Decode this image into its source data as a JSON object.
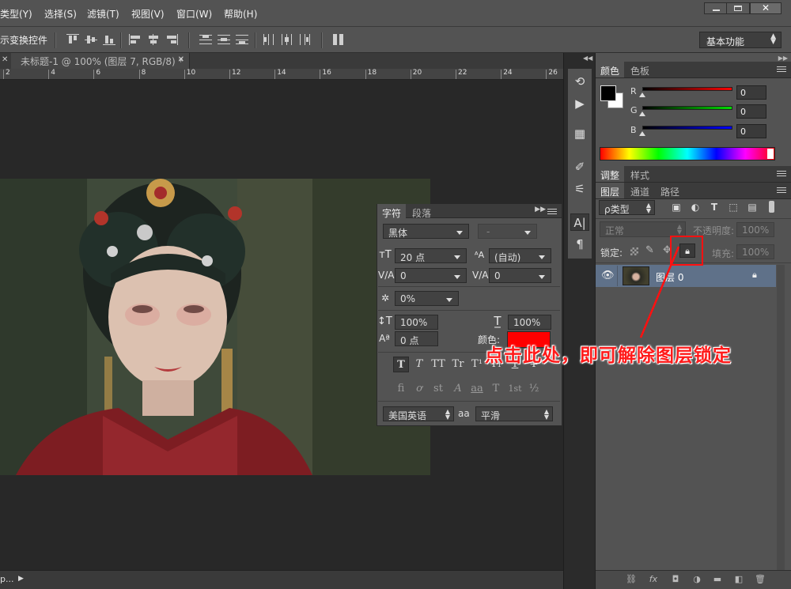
{
  "menu": {
    "items": [
      "类型(Y)",
      "选择(S)",
      "滤镜(T)",
      "视图(V)",
      "窗口(W)",
      "帮助(H)"
    ]
  },
  "options_bar": {
    "transform_label": "示变换控件",
    "workspace": "基本功能"
  },
  "document": {
    "tab_title": "未标题-1 @ 100% (图层 7, RGB/8) *",
    "ruler_labels": [
      "2",
      "4",
      "6",
      "8",
      "10",
      "12",
      "14",
      "16",
      "18",
      "20",
      "22",
      "24",
      "26"
    ],
    "status": "p..."
  },
  "color_panel": {
    "tabs": [
      "颜色",
      "色板"
    ],
    "channels": [
      {
        "label": "R",
        "value": "0",
        "color": "#ff0000"
      },
      {
        "label": "G",
        "value": "0",
        "color": "#00dd00"
      },
      {
        "label": "B",
        "value": "0",
        "color": "#0000ff"
      }
    ]
  },
  "adjust_panel": {
    "tabs": [
      "调整",
      "样式"
    ]
  },
  "layers_panel": {
    "tabs": [
      "图层",
      "通道",
      "路径"
    ],
    "filter_kind": "ρ类型",
    "blend_mode": "正常",
    "opacity_label": "不透明度:",
    "opacity_value": "100%",
    "lock_label": "锁定:",
    "fill_label": "填充:",
    "fill_value": "100%",
    "layer_name": "图层 0"
  },
  "character_panel": {
    "tabs": [
      "字符",
      "段落"
    ],
    "font_family": "黑体",
    "font_style": "-",
    "font_size": "20 点",
    "leading": "(自动)",
    "kerning": "0",
    "tracking": "0",
    "scale_percent": "0%",
    "vertical_scale": "100%",
    "horizontal_scale": "100%",
    "baseline_shift": "0 点",
    "color_label": "颜色:",
    "text_color": "#ff0000",
    "typo_buttons": [
      "T",
      "T",
      "TT",
      "Tr",
      "T¹",
      "T₁",
      "T",
      "T"
    ],
    "opentype_buttons": [
      "fi",
      "ơ",
      "st",
      "A",
      "aa",
      "T",
      "1st",
      "½"
    ],
    "language": "美国英语",
    "aa_label": "aa",
    "antialias": "平滑"
  },
  "annotation": {
    "text": "点击此处，即可解除图层锁定"
  }
}
